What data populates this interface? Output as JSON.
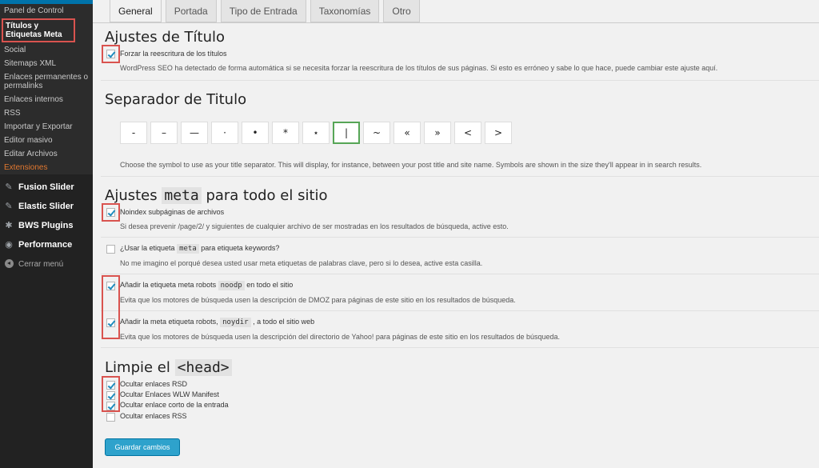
{
  "sidebar": {
    "sub_items": [
      {
        "label": "Panel de Control"
      },
      {
        "label": "Títulos y Etiquetas Meta"
      },
      {
        "label": "Social"
      },
      {
        "label": "Sitemaps XML"
      },
      {
        "label": "Enlaces permanentes o permalinks"
      },
      {
        "label": "Enlaces internos"
      },
      {
        "label": "RSS"
      },
      {
        "label": "Importar y Exportar"
      },
      {
        "label": "Editor masivo"
      },
      {
        "label": "Editar Archivos"
      },
      {
        "label": "Extensiones"
      }
    ],
    "main_items": [
      {
        "label": "Fusion Slider",
        "icon": "pin-icon"
      },
      {
        "label": "Elastic Slider",
        "icon": "pin-icon"
      },
      {
        "label": "BWS Plugins",
        "icon": "gear-icon"
      },
      {
        "label": "Performance",
        "icon": "gauge-icon"
      }
    ],
    "collapse_label": "Cerrar menú"
  },
  "tabs": [
    "General",
    "Portada",
    "Tipo de Entrada",
    "Taxonomías",
    "Otro"
  ],
  "title_section": {
    "heading": "Ajustes de Título",
    "force_label": "Forzar la reescritura de los títulos",
    "force_desc": "WordPress SEO ha detectado de forma automática si se necesita forzar la reescritura de los títulos de sus páginas. Si esto es erróneo y sabe lo que hace, puede cambiar este ajuste aquí."
  },
  "separator_section": {
    "heading": "Separador de Titulo",
    "symbols": [
      "-",
      "–",
      "—",
      "·",
      "•",
      "*",
      "⋆",
      "|",
      "~",
      "«",
      "»",
      "<",
      ">"
    ],
    "selected": "|",
    "desc": "Choose the symbol to use as your title separator. This will display, for instance, between your post title and site name. Symbols are shown in the size they'll appear in in search results."
  },
  "meta_section": {
    "heading_pre": "Ajustes",
    "heading_code": "meta",
    "heading_post": "para todo el sitio",
    "noindex_label": "Noindex subpáginas de archivos",
    "noindex_desc": "Si desea prevenir /page/2/ y siguientes de cualquier archivo de ser mostradas en los resultados de búsqueda, active esto.",
    "keywords_pre": "¿Usar la etiqueta",
    "keywords_code": "meta",
    "keywords_post": "para etiqueta keywords?",
    "keywords_desc": "No me imagino el porqué desea usted usar meta etiquetas de palabras clave, pero si lo desea, active esta casilla.",
    "noodp_pre": "Añadir la etiqueta meta robots",
    "noodp_code": "noodp",
    "noodp_post": "en todo el sitio",
    "noodp_desc": "Evita que los motores de búsqueda usen la descripción de DMOZ para páginas de este sitio en los resultados de búsqueda.",
    "noydir_pre": "Añadir la meta etiqueta robots,",
    "noydir_code": "noydir",
    "noydir_post": ", a todo el sitio web",
    "noydir_desc": "Evita que los motores de búsqueda usen la descripción del directorio de Yahoo! para páginas de este sitio en los resultados de búsqueda."
  },
  "head_section": {
    "heading_pre": "Limpie el",
    "heading_code": "<head>",
    "rsd_label": "Ocultar enlaces RSD",
    "wlw_label": "Ocultar Enlaces WLW Manifest",
    "short_label": "Ocultar enlace corto de la entrada",
    "rss_label": "Ocultar enlaces RSS"
  },
  "save_label": "Guardar cambios"
}
